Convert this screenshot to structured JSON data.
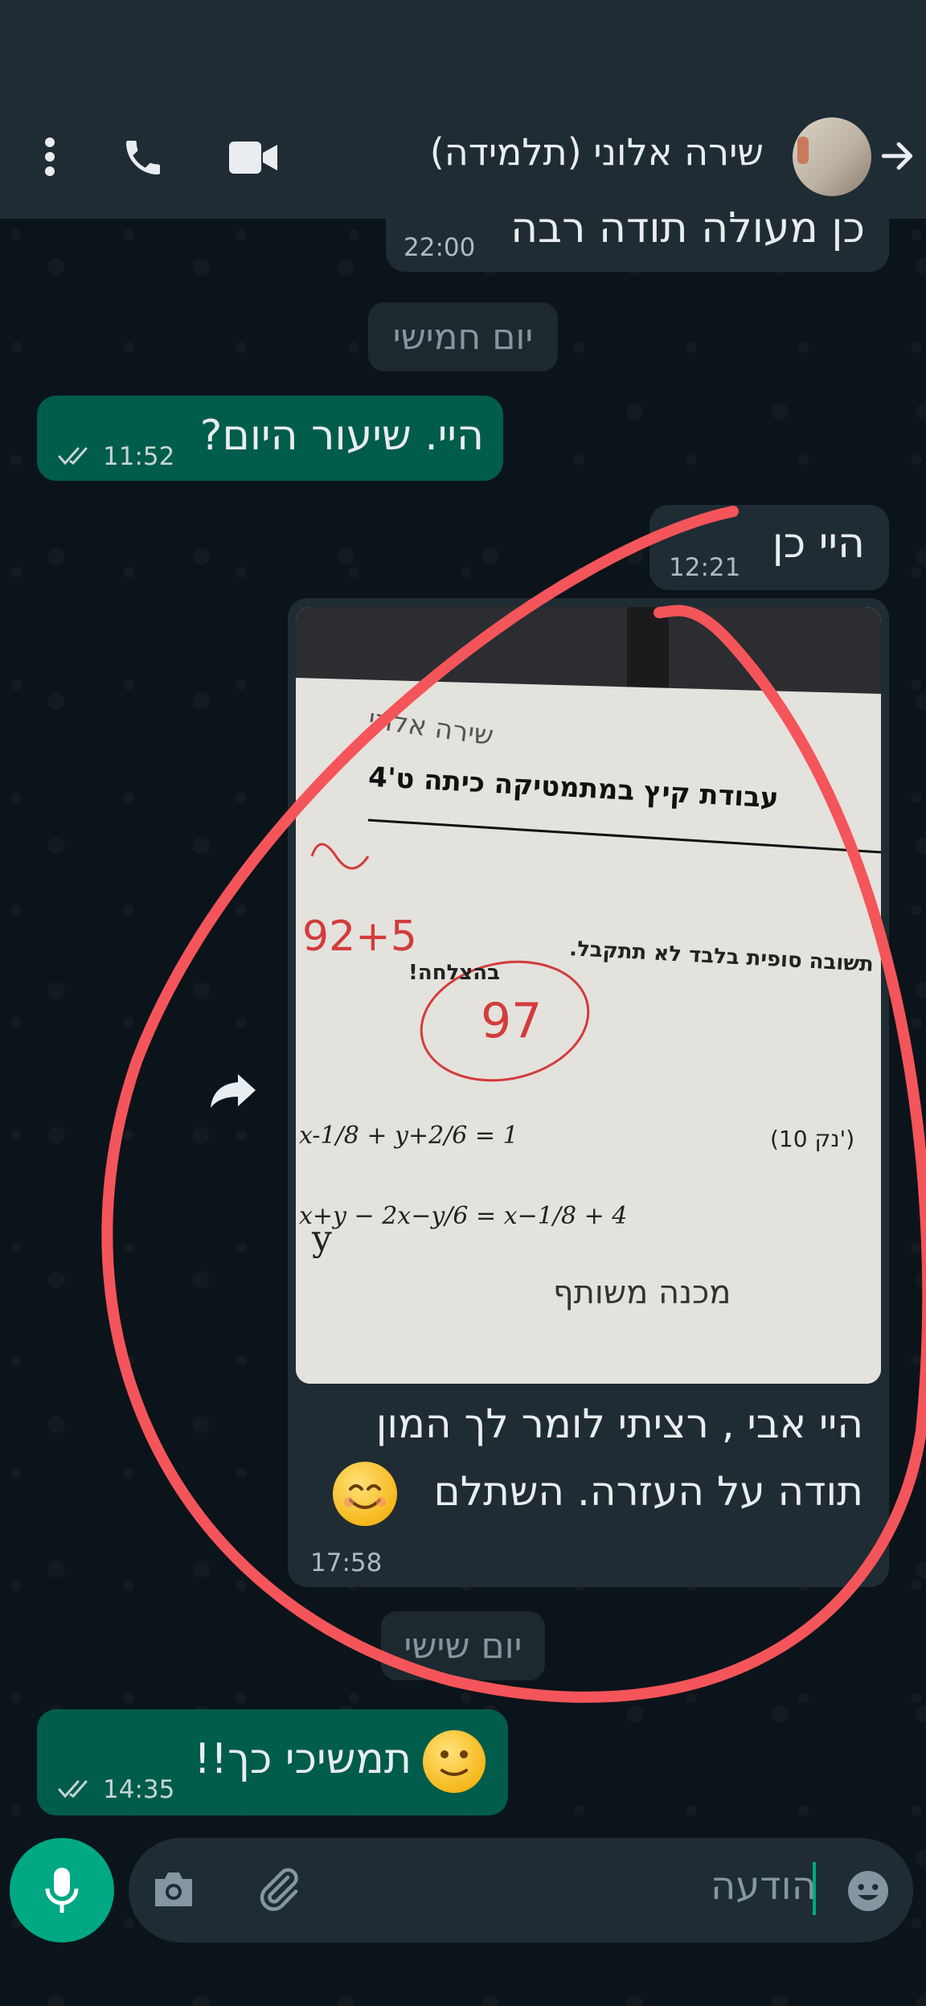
{
  "header": {
    "contact_name": "שירה אלוני (תלמידה)",
    "icons": [
      "back-arrow-icon",
      "video-call-icon",
      "voice-call-icon",
      "more-options-icon"
    ]
  },
  "messages": [
    {
      "type": "in",
      "text": "כן מעולה תודה רבה",
      "time": "22:00"
    },
    {
      "type": "day",
      "text": "יום חמישי"
    },
    {
      "type": "out",
      "text": "היי. שיעור היום?",
      "time": "11:52",
      "status": "read"
    },
    {
      "type": "in",
      "text": "היי כן",
      "time": "12:21"
    },
    {
      "type": "in-photo",
      "caption_line1": "היי אבי , רציתי לומר לך המון",
      "caption_line2": "תודה על העזרה. השתלם",
      "time": "17:58",
      "photo_text": {
        "title": "עבודת קיץ במתמטיקה כיתה ט'4",
        "name": "שירה אלוני",
        "success": "בהצלחה!",
        "final_answer_note": "תשובה סופית בלבד לא תתקבל.",
        "points": "(10 נק')",
        "grade": "97",
        "bonus": "92+5",
        "eq1": "x-1/8 + y+2/6 = 1",
        "eq2": "x+y − 2x−y/6 = x−1/8 + 4",
        "handwriting": "מכנה משותף"
      }
    },
    {
      "type": "day",
      "text": "יום שישי"
    },
    {
      "type": "out",
      "text": "תמשיכי כך!!",
      "time": "14:35",
      "status": "read"
    }
  ],
  "composer": {
    "placeholder": "הודעה",
    "icons": [
      "emoji-icon",
      "attach-icon",
      "camera-icon",
      "mic-icon"
    ]
  },
  "colors": {
    "header_bg": "#1f2c34",
    "chat_bg": "#0b141a",
    "incoming_bubble": "#202c33",
    "outgoing_bubble": "#005c4b",
    "accent": "#00a884",
    "annotation": "#f4555a"
  }
}
